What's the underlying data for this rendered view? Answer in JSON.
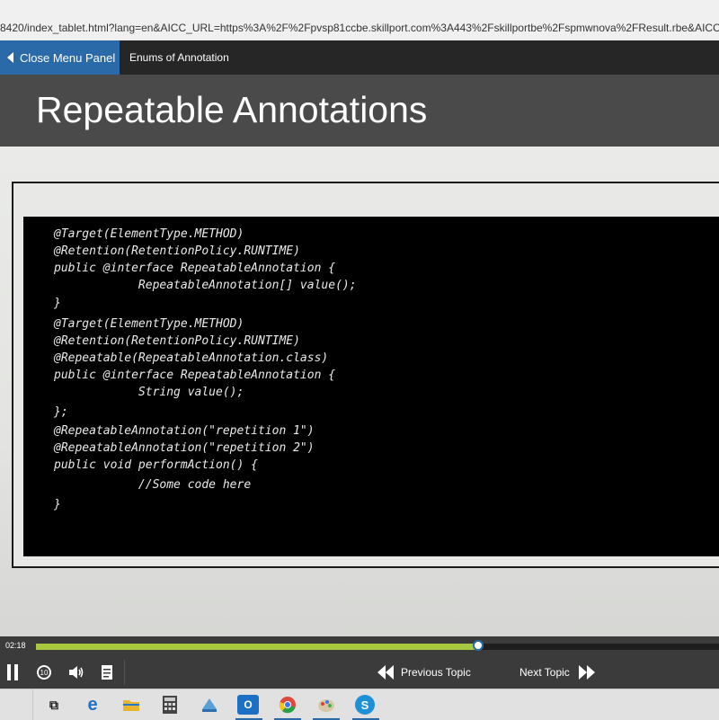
{
  "browser": {
    "url": "8420/index_tablet.html?lang=en&AICC_URL=https%3A%2F%2Fpvsp81ccbe.skillport.com%3A443%2Fskillportbe%2Fspmwnova%2FResult.rbe&AICC_"
  },
  "topnav": {
    "menu_button": "Close Menu Panel",
    "topic_title": "Enums of Annotation"
  },
  "slide": {
    "title": "Repeatable Annotations",
    "code_lines": [
      "@Target(ElementType.METHOD)",
      "@Retention(RetentionPolicy.RUNTIME)",
      "public @interface RepeatableAnnotation {",
      "            RepeatableAnnotation[] value();",
      "}",
      "@Target(ElementType.METHOD)",
      "@Retention(RetentionPolicy.RUNTIME)",
      "@Repeatable(RepeatableAnnotation.class)",
      "public @interface RepeatableAnnotation {",
      "            String value();",
      "};",
      "@RepeatableAnnotation(\"repetition 1\")",
      "@RepeatableAnnotation(\"repetition 2\")",
      "public void performAction() {",
      "            //Some code here",
      "}"
    ]
  },
  "player": {
    "time": "02:18",
    "progress": 0.647,
    "previous_label": "Previous Topic",
    "next_label": "Next Topic",
    "accent_color": "#a8c840"
  },
  "taskbar": {
    "icons": [
      "task-view-icon",
      "edge-icon",
      "file-explorer-icon",
      "calculator-icon",
      "app-icon",
      "outlook-icon",
      "chrome-icon",
      "paint-icon",
      "skype-icon"
    ]
  }
}
